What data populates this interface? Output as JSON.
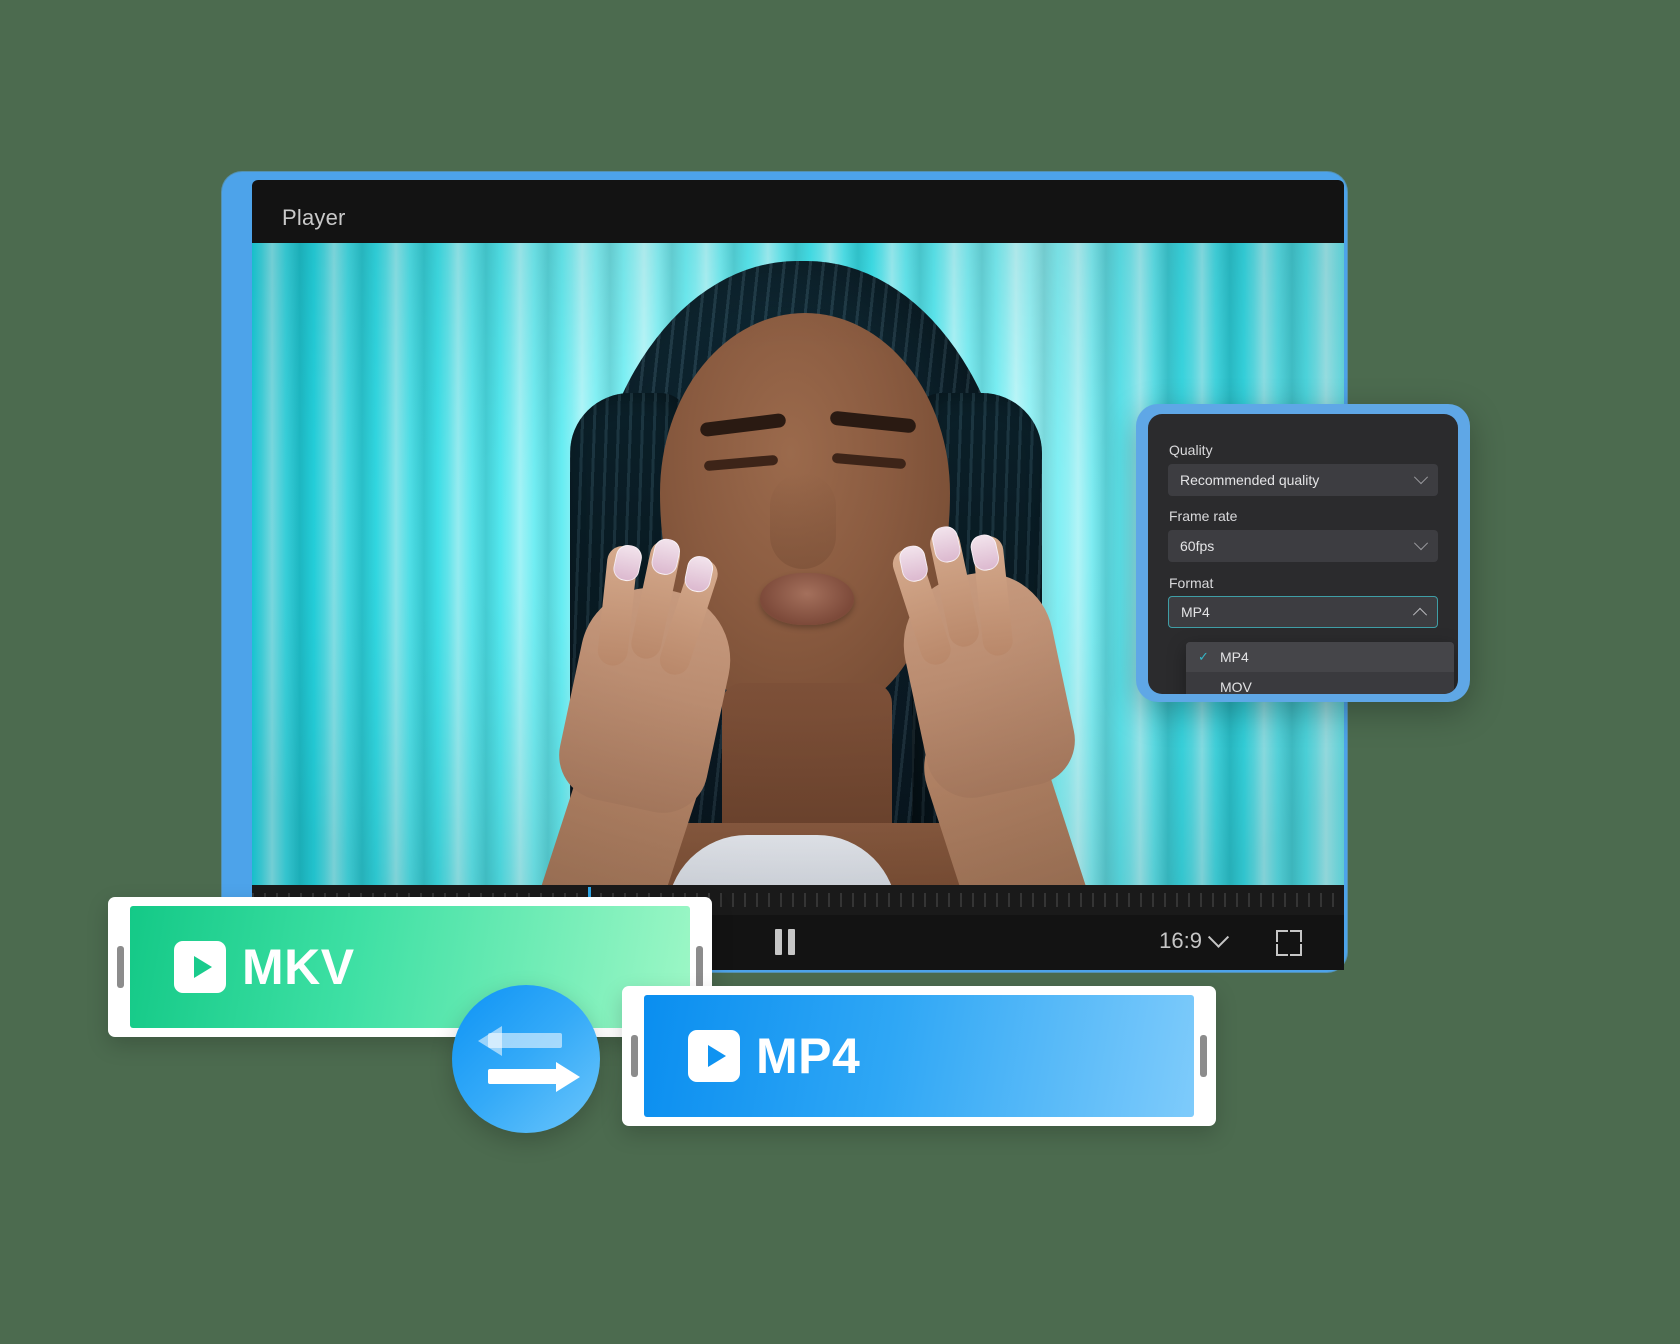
{
  "player": {
    "title": "Player",
    "controls": {
      "pause_label": "Pause",
      "aspect_ratio": "16:9",
      "fullscreen_label": "Fullscreen"
    }
  },
  "settings": {
    "quality": {
      "label": "Quality",
      "value": "Recommended quality"
    },
    "frame_rate": {
      "label": "Frame rate",
      "value": "60fps"
    },
    "format": {
      "label": "Format",
      "value": "MP4",
      "options": [
        {
          "label": "MP4",
          "selected": true,
          "check": "✓"
        },
        {
          "label": "MOV",
          "selected": false,
          "check": ""
        }
      ]
    }
  },
  "badges": {
    "source": {
      "label": "MKV",
      "icon": "video-play-icon"
    },
    "target": {
      "label": "MP4",
      "icon": "video-play-icon"
    },
    "swap": {
      "icon": "swap-arrows-icon"
    }
  },
  "colors": {
    "accent_blue": "#0d93f5",
    "frame_blue": "#4da3ea",
    "green_badge": "#14c987",
    "blue_badge": "#0a8ef0",
    "panel_bg": "#2b2b2d",
    "field_bg": "#3d3d41",
    "check_teal": "#35b6c7",
    "video_cyan": "#23e0e8"
  }
}
